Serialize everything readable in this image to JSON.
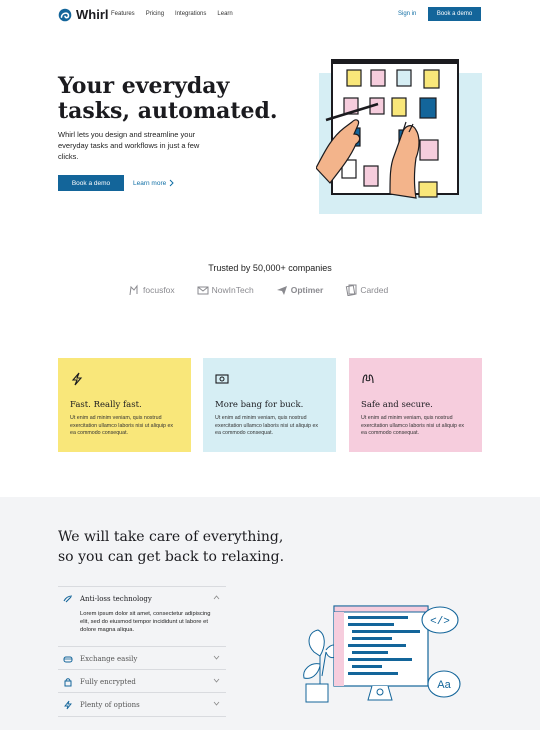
{
  "brand": {
    "name": "Whirl",
    "accent": "#13659a"
  },
  "nav": {
    "links": [
      "Features",
      "Pricing",
      "Integrations",
      "Learn"
    ],
    "sign_in": "Sign in",
    "cta": "Book a demo"
  },
  "hero": {
    "title": "Your everyday tasks, automated.",
    "subtitle": "Whirl lets you design and streamline your everyday tasks and workflows in just a few clicks.",
    "cta": "Book a demo",
    "secondary": "Learn more"
  },
  "trusted": {
    "heading": "Trusted by 50,000+ companies",
    "logos": [
      "focusfox",
      "NowInTech",
      "Optimer",
      "Carded"
    ]
  },
  "features": [
    {
      "title": "Fast. Really fast.",
      "text": "Ut enim ad minim veniam, quis nostrud exercitation ullamco laboris nisi ut aliquip ex ea commodo consequat.",
      "color": "#f9e77a",
      "icon": "lightning-icon"
    },
    {
      "title": "More bang for buck.",
      "text": "Ut enim ad minim veniam, quis nostrud exercitation ullamco laboris nisi ut aliquip ex ea commodo consequat.",
      "color": "#d6eef4",
      "icon": "money-icon"
    },
    {
      "title": "Safe and secure.",
      "text": "Ut enim ad minim veniam, quis nostrud exercitation ullamco laboris nisi ut aliquip ex ea commodo consequat.",
      "color": "#f6cddd",
      "icon": "hands-icon"
    }
  ],
  "care": {
    "title_line1": "We will take care of everything,",
    "title_line2": "so you can get back to relaxing.",
    "items": [
      {
        "label": "Anti-loss technology",
        "body": "Lorem ipsum dolor sit amet, consectetur adipiscing elit, sed do eiusmod tempor incididunt ut labore et dolore magna aliqua.",
        "expanded": true,
        "icon": "anti-loss-icon"
      },
      {
        "label": "Exchange easily",
        "expanded": false,
        "icon": "exchange-icon"
      },
      {
        "label": "Fully encrypted",
        "expanded": false,
        "icon": "lock-icon"
      },
      {
        "label": "Plenty of options",
        "expanded": false,
        "icon": "lightning-icon"
      }
    ]
  },
  "illustration": {
    "code_bubble": "</>",
    "font_bubble": "Aa"
  }
}
